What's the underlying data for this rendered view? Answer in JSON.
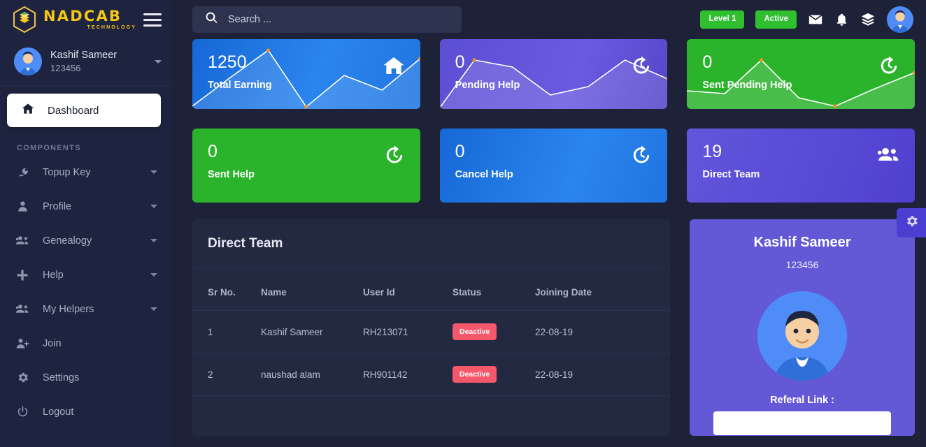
{
  "brand": {
    "name": "NADCAB",
    "sub": "TECHNOLOGY",
    "logo_icon": "hexagon-stack-logo",
    "menu_icon": "hamburger-icon"
  },
  "sidebar": {
    "user": {
      "name": "Kashif Sameer",
      "id": "123456",
      "avatar_icon": "user-avatar",
      "caret_icon": "chevron-down-icon"
    },
    "active_item": {
      "label": "Dashboard",
      "icon": "home-icon"
    },
    "section_title": "COMPONENTS",
    "items": [
      {
        "label": "Topup Key",
        "icon": "key-icon",
        "has_arrow": true
      },
      {
        "label": "Profile",
        "icon": "user-icon",
        "has_arrow": true
      },
      {
        "label": "Genealogy",
        "icon": "users-icon",
        "has_arrow": true
      },
      {
        "label": "Help",
        "icon": "plus-icon",
        "has_arrow": true
      },
      {
        "label": "My Helpers",
        "icon": "users-icon",
        "has_arrow": true
      },
      {
        "label": "Join",
        "icon": "user-plus-icon",
        "has_arrow": false
      },
      {
        "label": "Settings",
        "icon": "gear-icon",
        "has_arrow": false
      },
      {
        "label": "Logout",
        "icon": "power-icon",
        "has_arrow": false
      }
    ]
  },
  "topbar": {
    "search_placeholder": "Search ...",
    "search_icon": "search-icon",
    "level_badge": "Level 1",
    "status_badge": "Active",
    "mail_icon": "envelope-icon",
    "bell_icon": "bell-icon",
    "layers_icon": "layers-icon",
    "avatar_icon": "user-avatar"
  },
  "cards": [
    {
      "value": "1250",
      "label": "Total Earning",
      "icon": "home-icon",
      "color": "#1f74e0",
      "theme": "c-blue"
    },
    {
      "value": "0",
      "label": "Pending Help",
      "icon": "history-icon",
      "color": "#5b4fd4",
      "theme": "c-purple"
    },
    {
      "value": "0",
      "label": "Sent Pending Help",
      "icon": "history-icon",
      "color": "#2cb32c",
      "theme": "c-green"
    },
    {
      "value": "0",
      "label": "Sent Help",
      "icon": "history-icon",
      "color": "#2cb32c",
      "theme": "c-green"
    },
    {
      "value": "0",
      "label": "Cancel Help",
      "icon": "history-icon",
      "color": "#1f74e0",
      "theme": "c-blue2"
    },
    {
      "value": "19",
      "label": "Direct Team",
      "icon": "users-icon",
      "color": "#5446c9",
      "theme": "c-purple2"
    }
  ],
  "direct_team": {
    "title": "Direct Team",
    "columns": [
      "Sr No.",
      "Name",
      "User Id",
      "Status",
      "Joining Date"
    ],
    "rows": [
      {
        "sr": "1",
        "name": "Kashif Sameer",
        "user_id": "RH213071",
        "status": "Deactive",
        "joined": "22-08-19"
      },
      {
        "sr": "2",
        "name": "naushad alam",
        "user_id": "RH901142",
        "status": "Deactive",
        "joined": "22-08-19"
      }
    ]
  },
  "profile_card": {
    "name": "Kashif Sameer",
    "id": "123456",
    "avatar_icon": "user-avatar",
    "referral_label": "Referal Link :",
    "referral_value": ""
  },
  "settings_tab": {
    "icon": "gear-icon"
  },
  "colors": {
    "page_bg": "#1d2238",
    "sidebar_bg": "#1e2440",
    "panel_bg": "#232941",
    "accent_yellow": "#f5c518",
    "accent_green": "#2fbf2f",
    "accent_blue": "#1f74e0",
    "accent_purple": "#6359d6",
    "danger_red": "#f4586a"
  }
}
